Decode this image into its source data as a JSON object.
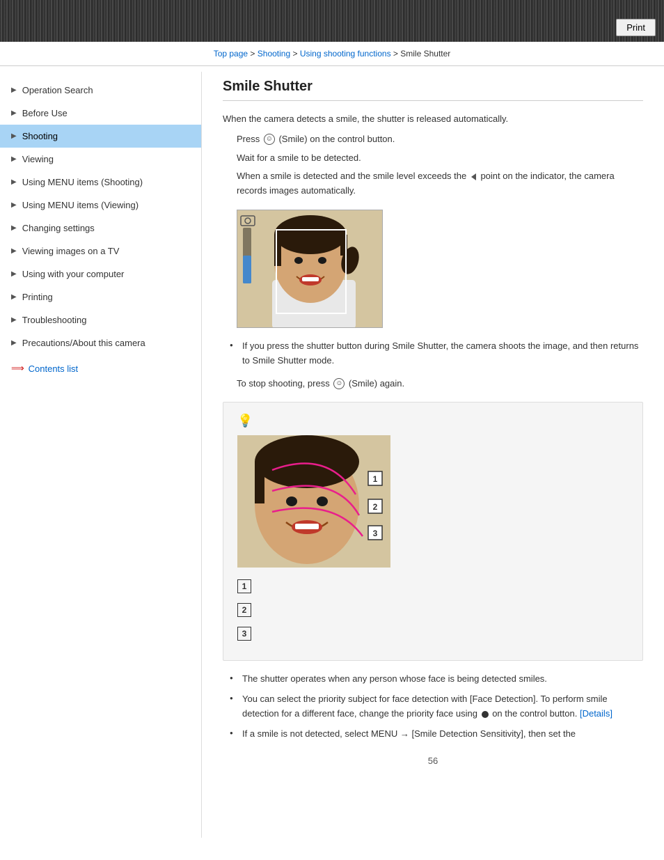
{
  "header": {
    "print_label": "Print"
  },
  "breadcrumb": {
    "top_page": "Top page",
    "separator1": " > ",
    "shooting": "Shooting",
    "separator2": " > ",
    "using_shooting_functions": "Using shooting functions",
    "separator3": " > ",
    "smile_shutter": "Smile Shutter"
  },
  "sidebar": {
    "items": [
      {
        "id": "operation-search",
        "label": "Operation Search",
        "active": false
      },
      {
        "id": "before-use",
        "label": "Before Use",
        "active": false
      },
      {
        "id": "shooting",
        "label": "Shooting",
        "active": true
      },
      {
        "id": "viewing",
        "label": "Viewing",
        "active": false
      },
      {
        "id": "using-menu-shooting",
        "label": "Using MENU items (Shooting)",
        "active": false
      },
      {
        "id": "using-menu-viewing",
        "label": "Using MENU items (Viewing)",
        "active": false
      },
      {
        "id": "changing-settings",
        "label": "Changing settings",
        "active": false
      },
      {
        "id": "viewing-tv",
        "label": "Viewing images on a TV",
        "active": false
      },
      {
        "id": "using-computer",
        "label": "Using with your computer",
        "active": false
      },
      {
        "id": "printing",
        "label": "Printing",
        "active": false
      },
      {
        "id": "troubleshooting",
        "label": "Troubleshooting",
        "active": false
      },
      {
        "id": "precautions",
        "label": "Precautions/About this camera",
        "active": false
      }
    ],
    "contents_list_label": "Contents list"
  },
  "main": {
    "page_title": "Smile Shutter",
    "intro_text": "When the camera detects a smile, the shutter is released automatically.",
    "step1": "Press  (Smile) on the control button.",
    "step2": "Wait for a smile to be detected.",
    "step3": "When a smile is detected and the smile level exceeds the  point on the indicator, the camera records images automatically.",
    "bullet1": "If you press the shutter button during Smile Shutter, the camera shoots the image, and then returns to Smile Shutter mode.",
    "stop_shooting": "To stop shooting, press  (Smile) again.",
    "number_items": [
      {
        "num": "1",
        "text": ""
      },
      {
        "num": "2",
        "text": ""
      },
      {
        "num": "3",
        "text": ""
      }
    ],
    "notes": [
      "The shutter operates when any person whose face is being detected smiles.",
      "You can select the priority subject for face detection with [Face Detection]. To perform smile detection for a different face, change the priority face using  on the control button.",
      "If a smile is not detected, select MENU → [Smile Detection Sensitivity], then set the"
    ],
    "details_link": "[Details]",
    "page_number": "56"
  }
}
